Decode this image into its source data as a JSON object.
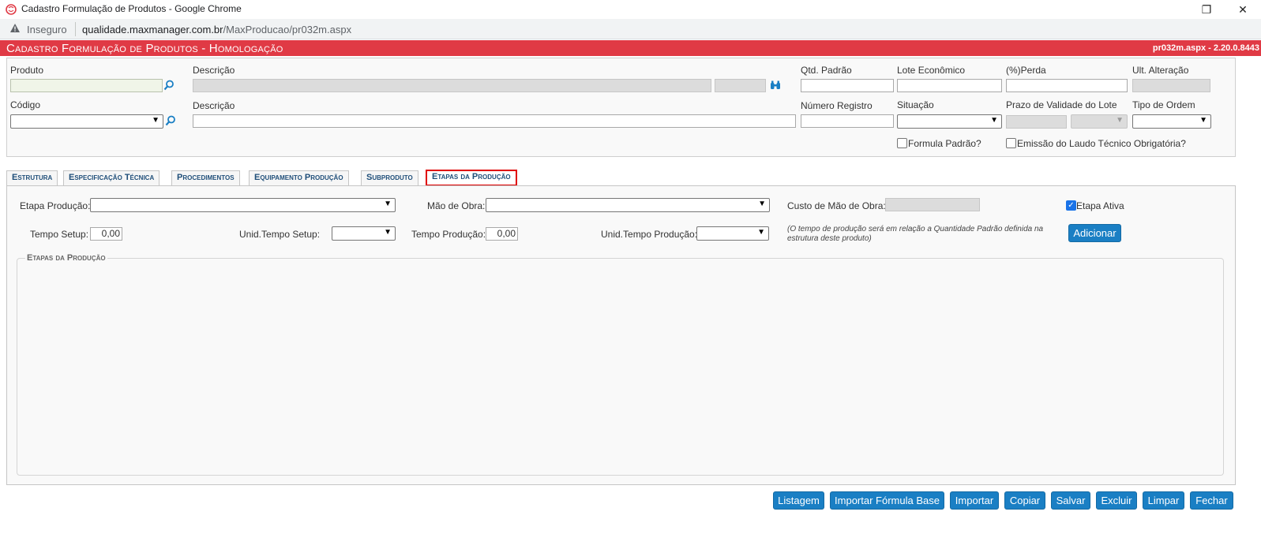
{
  "window": {
    "title": "Cadastro Formulação de Produtos - Google Chrome",
    "restore_glyph": "❐",
    "close_glyph": "✕"
  },
  "address": {
    "security_label": "Inseguro",
    "host": "qualidade.maxmanager.com.br",
    "path": "/MaxProducao/pr032m.aspx"
  },
  "header": {
    "title": "Cadastro Formulação de Produtos  - Homologação",
    "version": "pr032m.aspx - 2.20.0.8443"
  },
  "form": {
    "produto_label": "Produto",
    "descricao_label": "Descrição",
    "qtd_padrao_label": "Qtd. Padrão",
    "lote_economico_label": "Lote Econômico",
    "perda_label": "(%)Perda",
    "ult_alteracao_label": "Ult. Alteração",
    "codigo_label": "Código",
    "descricao2_label": "Descrição",
    "numero_registro_label": "Número Registro",
    "situacao_label": "Situação",
    "prazo_validade_label": "Prazo de Validade do Lote",
    "tipo_ordem_label": "Tipo de Ordem",
    "formula_padrao_label": "Formula Padrão?",
    "emissao_laudo_label": "Emissão do Laudo Técnico Obrigatória?"
  },
  "tabs": [
    {
      "label": "Estrutura"
    },
    {
      "label": "Especificação Técnica"
    },
    {
      "label": "Procedimentos"
    },
    {
      "label": "Equipamento Produção"
    },
    {
      "label": "Subproduto"
    },
    {
      "label": "Etapas da Produção"
    }
  ],
  "etapas": {
    "etapa_producao_label": "Etapa Produção:",
    "mao_de_obra_label": "Mão de Obra:",
    "custo_mao_obra_label": "Custo de Mão de Obra:",
    "etapa_ativa_label": "Etapa Ativa",
    "tempo_setup_label": "Tempo Setup:",
    "tempo_setup_value": "0,00",
    "unid_tempo_setup_label": "Unid.Tempo Setup:",
    "tempo_producao_label": "Tempo Produção:",
    "tempo_producao_value": "0,00",
    "unid_tempo_producao_label": "Unid.Tempo Produção:",
    "note_line1": "(O tempo de produção será em relação a Quantidade Padrão definida na",
    "note_line2": "estrutura deste produto)",
    "adicionar_label": "Adicionar",
    "fieldset_legend": "Etapas da Produção"
  },
  "footer_buttons": [
    {
      "label": "Listagem"
    },
    {
      "label": "Importar Fórmula Base"
    },
    {
      "label": "Importar"
    },
    {
      "label": "Copiar"
    },
    {
      "label": "Salvar"
    },
    {
      "label": "Excluir"
    },
    {
      "label": "Limpar"
    },
    {
      "label": "Fechar"
    }
  ],
  "colors": {
    "header_red": "#e03a45",
    "button_blue": "#1a7fc4",
    "tab_text": "#1f4e79",
    "active_tab_border": "#e00000"
  }
}
